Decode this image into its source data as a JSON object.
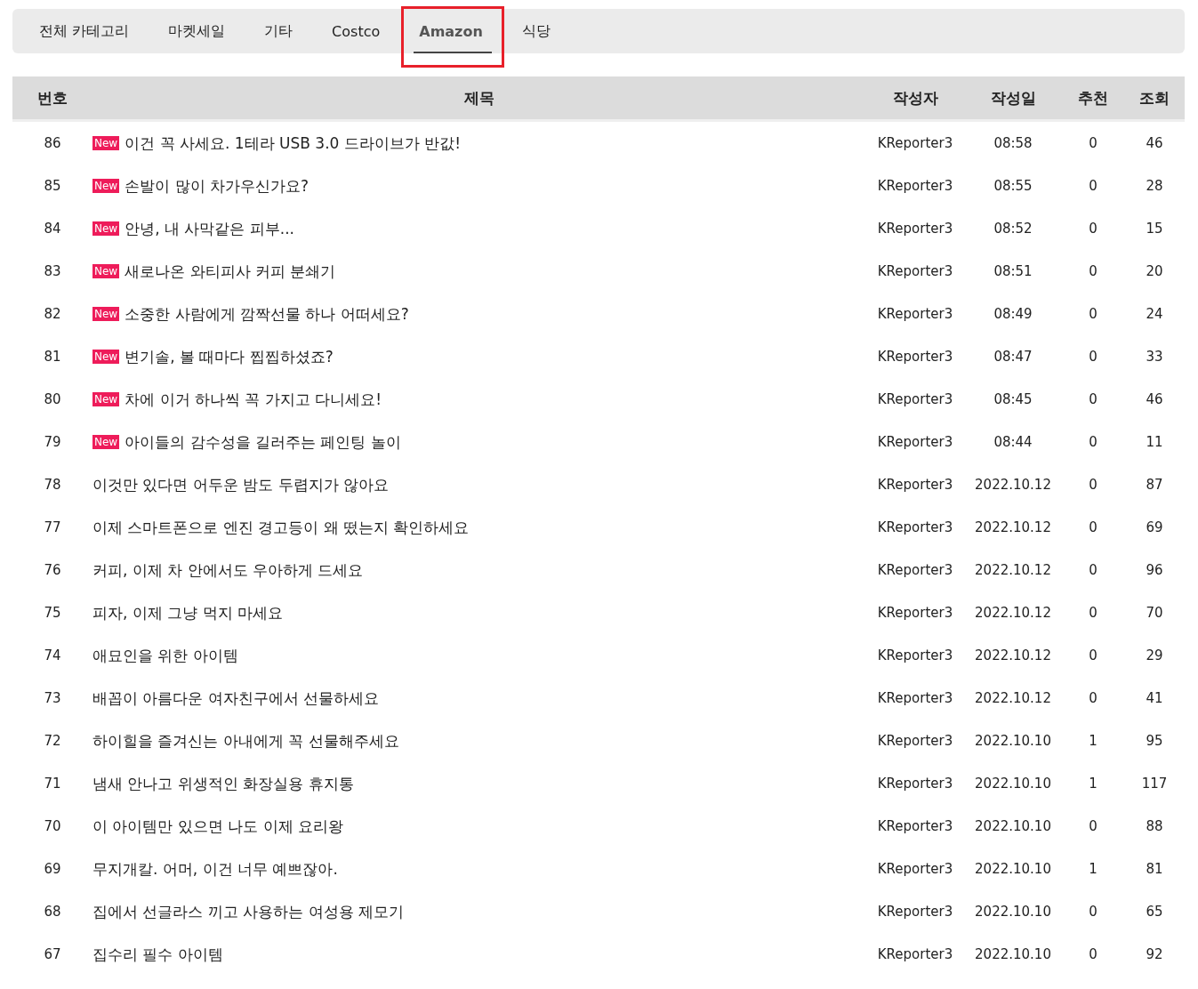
{
  "tabs": [
    {
      "label": "전체 카테고리",
      "selected": false,
      "highlighted": false
    },
    {
      "label": "마켓세일",
      "selected": false,
      "highlighted": false
    },
    {
      "label": "기타",
      "selected": false,
      "highlighted": false
    },
    {
      "label": "Costco",
      "selected": false,
      "highlighted": false
    },
    {
      "label": "Amazon",
      "selected": true,
      "highlighted": true
    },
    {
      "label": "식당",
      "selected": false,
      "highlighted": false
    }
  ],
  "table": {
    "columns": [
      "번호",
      "제목",
      "작성자",
      "작성일",
      "추천",
      "조회"
    ],
    "rows": [
      {
        "number": "86",
        "badge": "New",
        "title": "이건 꼭 사세요. 1테라 USB 3.0 드라이브가 반값!",
        "author": "KReporter3",
        "date": "08:58",
        "likes": "0",
        "views": "46"
      },
      {
        "number": "85",
        "badge": "New",
        "title": "손발이 많이 차가우신가요?",
        "author": "KReporter3",
        "date": "08:55",
        "likes": "0",
        "views": "28"
      },
      {
        "number": "84",
        "badge": "New",
        "title": "안녕, 내 사막같은 피부...",
        "author": "KReporter3",
        "date": "08:52",
        "likes": "0",
        "views": "15"
      },
      {
        "number": "83",
        "badge": "New",
        "title": "새로나온 와티피사 커피 분쇄기",
        "author": "KReporter3",
        "date": "08:51",
        "likes": "0",
        "views": "20"
      },
      {
        "number": "82",
        "badge": "New",
        "title": "소중한 사람에게 깜짝선물 하나 어떠세요?",
        "author": "KReporter3",
        "date": "08:49",
        "likes": "0",
        "views": "24"
      },
      {
        "number": "81",
        "badge": "New",
        "title": "변기솔, 볼 때마다 찝찝하셨죠?",
        "author": "KReporter3",
        "date": "08:47",
        "likes": "0",
        "views": "33"
      },
      {
        "number": "80",
        "badge": "New",
        "title": "차에 이거 하나씩 꼭 가지고 다니세요!",
        "author": "KReporter3",
        "date": "08:45",
        "likes": "0",
        "views": "46"
      },
      {
        "number": "79",
        "badge": "New",
        "title": "아이들의 감수성을 길러주는 페인팅 놀이",
        "author": "KReporter3",
        "date": "08:44",
        "likes": "0",
        "views": "11"
      },
      {
        "number": "78",
        "title": "이것만 있다면 어두운 밤도 두렵지가 않아요",
        "author": "KReporter3",
        "date": "2022.10.12",
        "likes": "0",
        "views": "87"
      },
      {
        "number": "77",
        "title": "이제 스마트폰으로 엔진 경고등이 왜 떴는지 확인하세요",
        "author": "KReporter3",
        "date": "2022.10.12",
        "likes": "0",
        "views": "69"
      },
      {
        "number": "76",
        "title": "커피, 이제 차 안에서도 우아하게 드세요",
        "author": "KReporter3",
        "date": "2022.10.12",
        "likes": "0",
        "views": "96"
      },
      {
        "number": "75",
        "title": "피자, 이제 그냥 먹지 마세요",
        "author": "KReporter3",
        "date": "2022.10.12",
        "likes": "0",
        "views": "70"
      },
      {
        "number": "74",
        "title": "애묘인을 위한 아이템",
        "author": "KReporter3",
        "date": "2022.10.12",
        "likes": "0",
        "views": "29"
      },
      {
        "number": "73",
        "title": "배꼽이 아름다운 여자친구에서 선물하세요",
        "author": "KReporter3",
        "date": "2022.10.12",
        "likes": "0",
        "views": "41"
      },
      {
        "number": "72",
        "title": "하이힐을 즐겨신는 아내에게 꼭 선물해주세요",
        "author": "KReporter3",
        "date": "2022.10.10",
        "likes": "1",
        "views": "95"
      },
      {
        "number": "71",
        "title": "냄새 안나고 위생적인 화장실용 휴지통",
        "author": "KReporter3",
        "date": "2022.10.10",
        "likes": "1",
        "views": "117"
      },
      {
        "number": "70",
        "title": "이 아이템만 있으면 나도 이제 요리왕",
        "author": "KReporter3",
        "date": "2022.10.10",
        "likes": "0",
        "views": "88"
      },
      {
        "number": "69",
        "title": "무지개칼. 어머, 이건 너무 예쁘잖아.",
        "author": "KReporter3",
        "date": "2022.10.10",
        "likes": "1",
        "views": "81"
      },
      {
        "number": "68",
        "title": "집에서 선글라스 끼고 사용하는 여성용 제모기",
        "author": "KReporter3",
        "date": "2022.10.10",
        "likes": "0",
        "views": "65"
      },
      {
        "number": "67",
        "title": "집수리 필수 아이템",
        "author": "KReporter3",
        "date": "2022.10.10",
        "likes": "0",
        "views": "92"
      }
    ]
  }
}
